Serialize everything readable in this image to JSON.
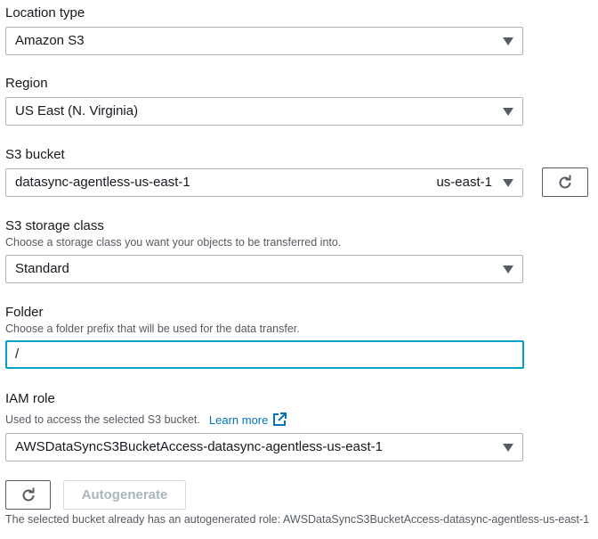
{
  "location_type": {
    "label": "Location type",
    "value": "Amazon S3"
  },
  "region": {
    "label": "Region",
    "value": "US East (N. Virginia)"
  },
  "s3_bucket": {
    "label": "S3 bucket",
    "value": "datasync-agentless-us-east-1",
    "region_tag": "us-east-1"
  },
  "storage_class": {
    "label": "S3 storage class",
    "description": "Choose a storage class you want your objects to be transferred into.",
    "value": "Standard"
  },
  "folder": {
    "label": "Folder",
    "description": "Choose a folder prefix that will be used for the data transfer.",
    "value": "/"
  },
  "iam_role": {
    "label": "IAM role",
    "description": "Used to access the selected S3 bucket.",
    "learn_more": "Learn more",
    "value": "AWSDataSyncS3BucketAccess-datasync-agentless-us-east-1",
    "autogenerate_label": "Autogenerate",
    "note": "The selected bucket already has an autogenerated role: AWSDataSyncS3BucketAccess-datasync-agentless-us-east-1"
  },
  "colors": {
    "focus": "#00a1c9",
    "link": "#0073bb"
  }
}
